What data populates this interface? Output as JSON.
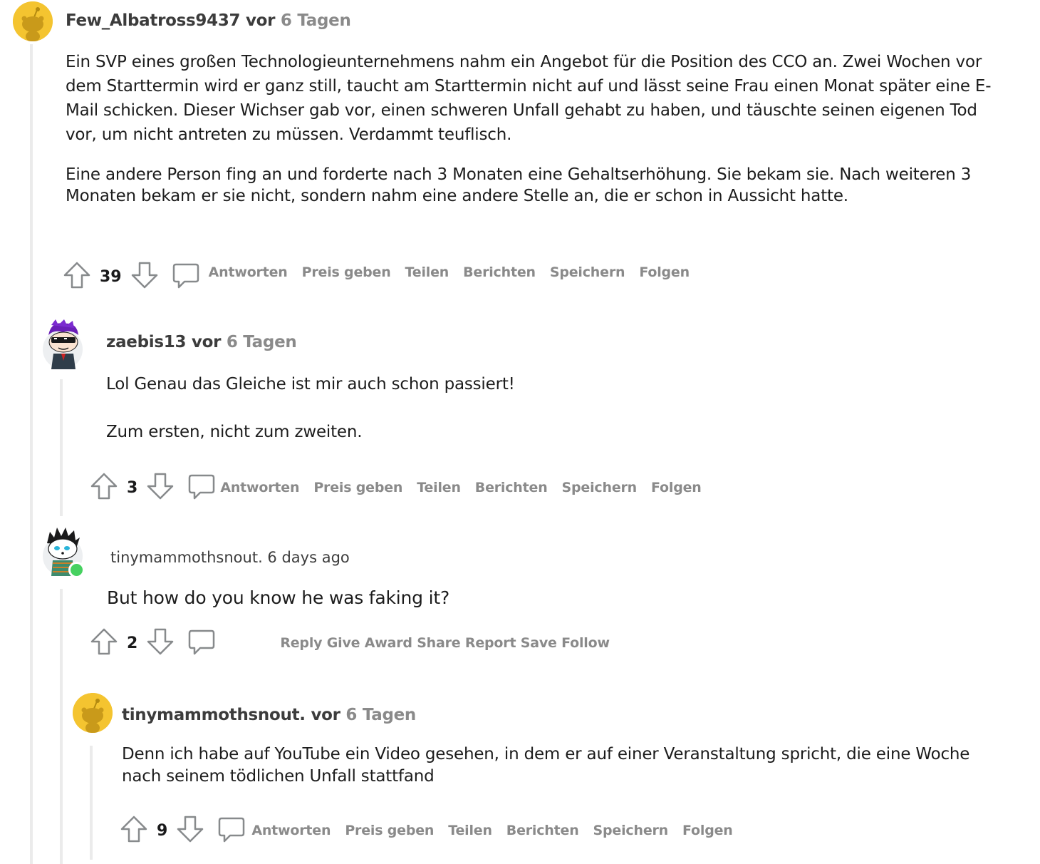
{
  "comments": [
    {
      "username": "Few_Albatross9437",
      "vor": "vor",
      "time": "6 Tagen",
      "paragraphs": [
        "Ein SVP eines großen Technologieunternehmens nahm ein Angebot für die Position des CCO an. Zwei Wochen vor dem Starttermin wird er ganz still, taucht am Starttermin nicht auf und lässt seine Frau einen Monat später eine E-Mail schicken. Dieser Wichser gab vor, einen schweren Unfall gehabt zu haben, und täuschte seinen eigenen Tod vor, um nicht antreten zu müssen. Verdammt teuflisch.",
        "Eine andere Person fing an und forderte nach 3 Monaten eine Gehaltserhöhung. Sie bekam sie. Nach weiteren 3 Monaten bekam er sie nicht, sondern nahm eine andere Stelle an, die er schon in Aussicht hatte."
      ],
      "votes": "39"
    },
    {
      "username": "zaebis13",
      "vor": "vor",
      "time": "6 Tagen",
      "paragraphs": [
        "Lol Genau das Gleiche ist mir auch schon passiert!",
        "Zum ersten, nicht zum zweiten."
      ],
      "votes": "3"
    },
    {
      "meta_plain": "tinymammothsnout. 6 days ago",
      "paragraphs": [
        "But how do you know he was faking it?"
      ],
      "votes": "2",
      "actions_en": "Reply Give Award Share Report Save Follow"
    },
    {
      "username": "tinymammothsnout.",
      "vor": "vor",
      "time": "6 Tagen",
      "paragraphs": [
        "Denn ich habe auf YouTube ein Video gesehen, in dem er auf einer Veranstaltung spricht, die eine Woche nach seinem tödlichen Unfall stattfand"
      ],
      "votes": "9"
    }
  ],
  "actions": {
    "reply": "Antworten",
    "award": "Preis geben",
    "share": "Teilen",
    "report": "Berichten",
    "save": "Speichern",
    "follow": "Folgen"
  },
  "colors": {
    "snoo_yellow": "#f4c430",
    "muted": "#8a8a8a",
    "online": "#46d160"
  }
}
